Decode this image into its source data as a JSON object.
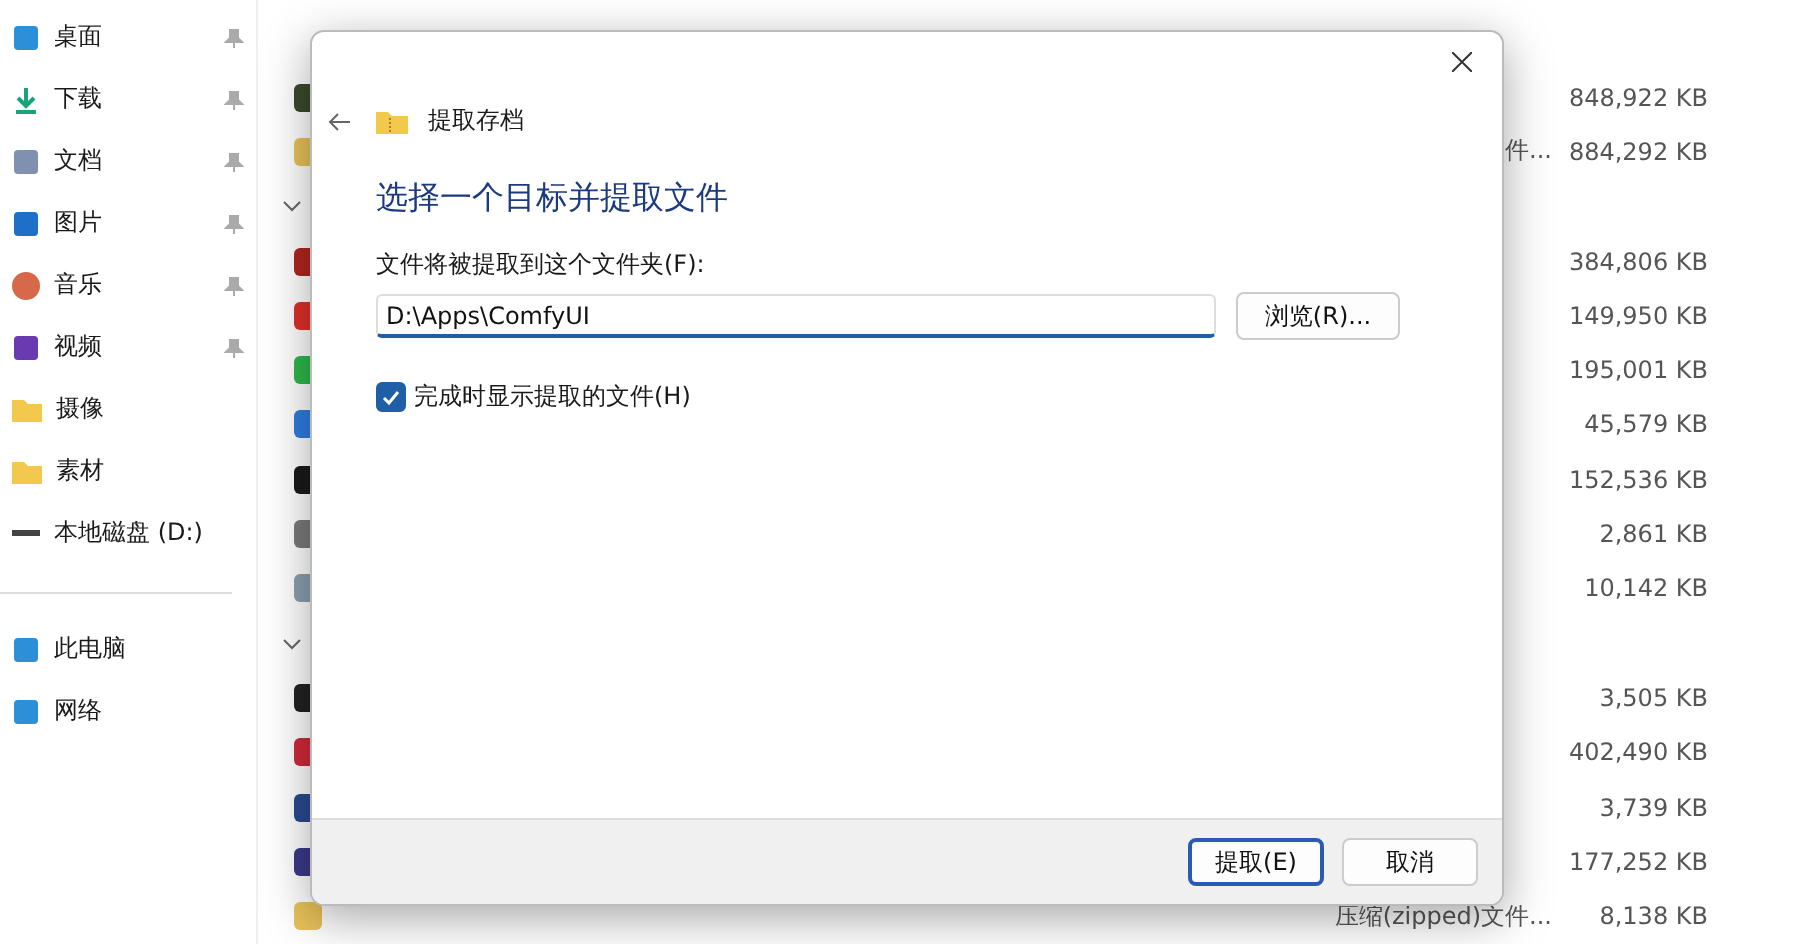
{
  "sidebar": {
    "items": [
      {
        "label": "桌面",
        "pinned": true
      },
      {
        "label": "下载",
        "pinned": true
      },
      {
        "label": "文档",
        "pinned": true
      },
      {
        "label": "图片",
        "pinned": true
      },
      {
        "label": "音乐",
        "pinned": true
      },
      {
        "label": "视频",
        "pinned": true
      },
      {
        "label": "摄像",
        "pinned": false
      },
      {
        "label": "素材",
        "pinned": false
      },
      {
        "label": "本地磁盘 (D:)",
        "pinned": false
      }
    ],
    "bottom_items": [
      {
        "label": "此电脑"
      },
      {
        "label": "网络"
      }
    ]
  },
  "files": [
    {
      "kind": "file",
      "size": "848,922 KB"
    },
    {
      "kind": "file",
      "type": "件...",
      "size": "884,292 KB"
    },
    {
      "kind": "group",
      "expanded": true
    },
    {
      "kind": "file",
      "size": "384,806 KB"
    },
    {
      "kind": "file",
      "size": "149,950 KB"
    },
    {
      "kind": "file",
      "size": "195,001 KB"
    },
    {
      "kind": "file",
      "size": "45,579 KB"
    },
    {
      "kind": "file",
      "size": "152,536 KB"
    },
    {
      "kind": "file",
      "size": "2,861 KB"
    },
    {
      "kind": "file",
      "size": "10,142 KB"
    },
    {
      "kind": "group",
      "expanded": true
    },
    {
      "kind": "file",
      "size": "3,505 KB"
    },
    {
      "kind": "file",
      "size": "402,490 KB"
    },
    {
      "kind": "file",
      "size": "3,739 KB"
    },
    {
      "kind": "file",
      "size": "177,252 KB"
    },
    {
      "kind": "file",
      "type": "压缩(zipped)文件...",
      "size": "8,138 KB"
    }
  ],
  "dialog": {
    "title": "提取存档",
    "heading": "选择一个目标并提取文件",
    "folder_label": "文件将被提取到这个文件夹(F):",
    "folder_value": "D:\\Apps\\ComfyUI",
    "browse_button": "浏览(R)...",
    "show_files": {
      "label": "完成时显示提取的文件(H)",
      "checked": true
    },
    "buttons": [
      {
        "label": "提取(E)",
        "default": true
      },
      {
        "label": "取消",
        "default": false
      }
    ]
  }
}
